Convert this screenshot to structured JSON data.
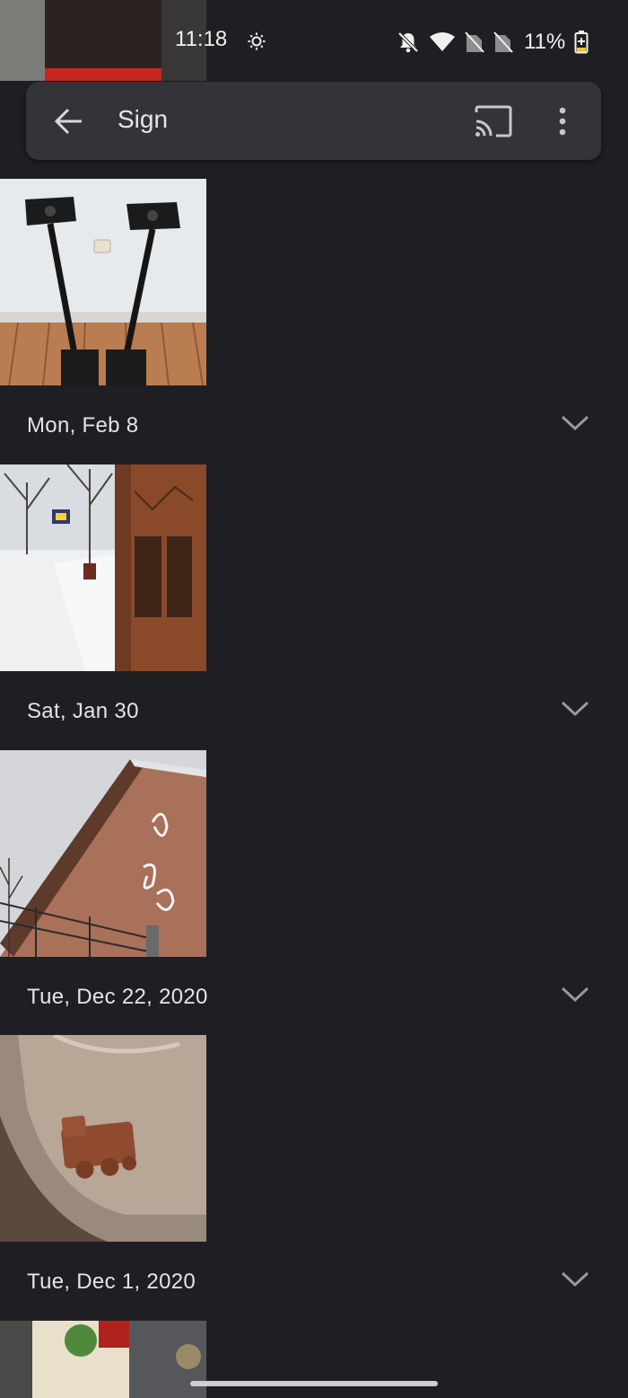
{
  "status_bar": {
    "time": "11:18",
    "battery": "11%"
  },
  "search": {
    "query": "Sign"
  },
  "groups": [
    {
      "date": "Mon, Feb 8"
    },
    {
      "date": "Sat, Jan 30"
    },
    {
      "date": "Tue, Dec 22, 2020"
    },
    {
      "date": "Tue, Dec 1, 2020"
    }
  ],
  "icons": {
    "back": "arrow-left-icon",
    "cast": "cast-icon",
    "more": "more-vert-icon",
    "expand": "chevron-down-icon"
  },
  "colors": {
    "background": "#1f1f23",
    "search_bar": "#33343a",
    "text": "#e4e4e6"
  }
}
